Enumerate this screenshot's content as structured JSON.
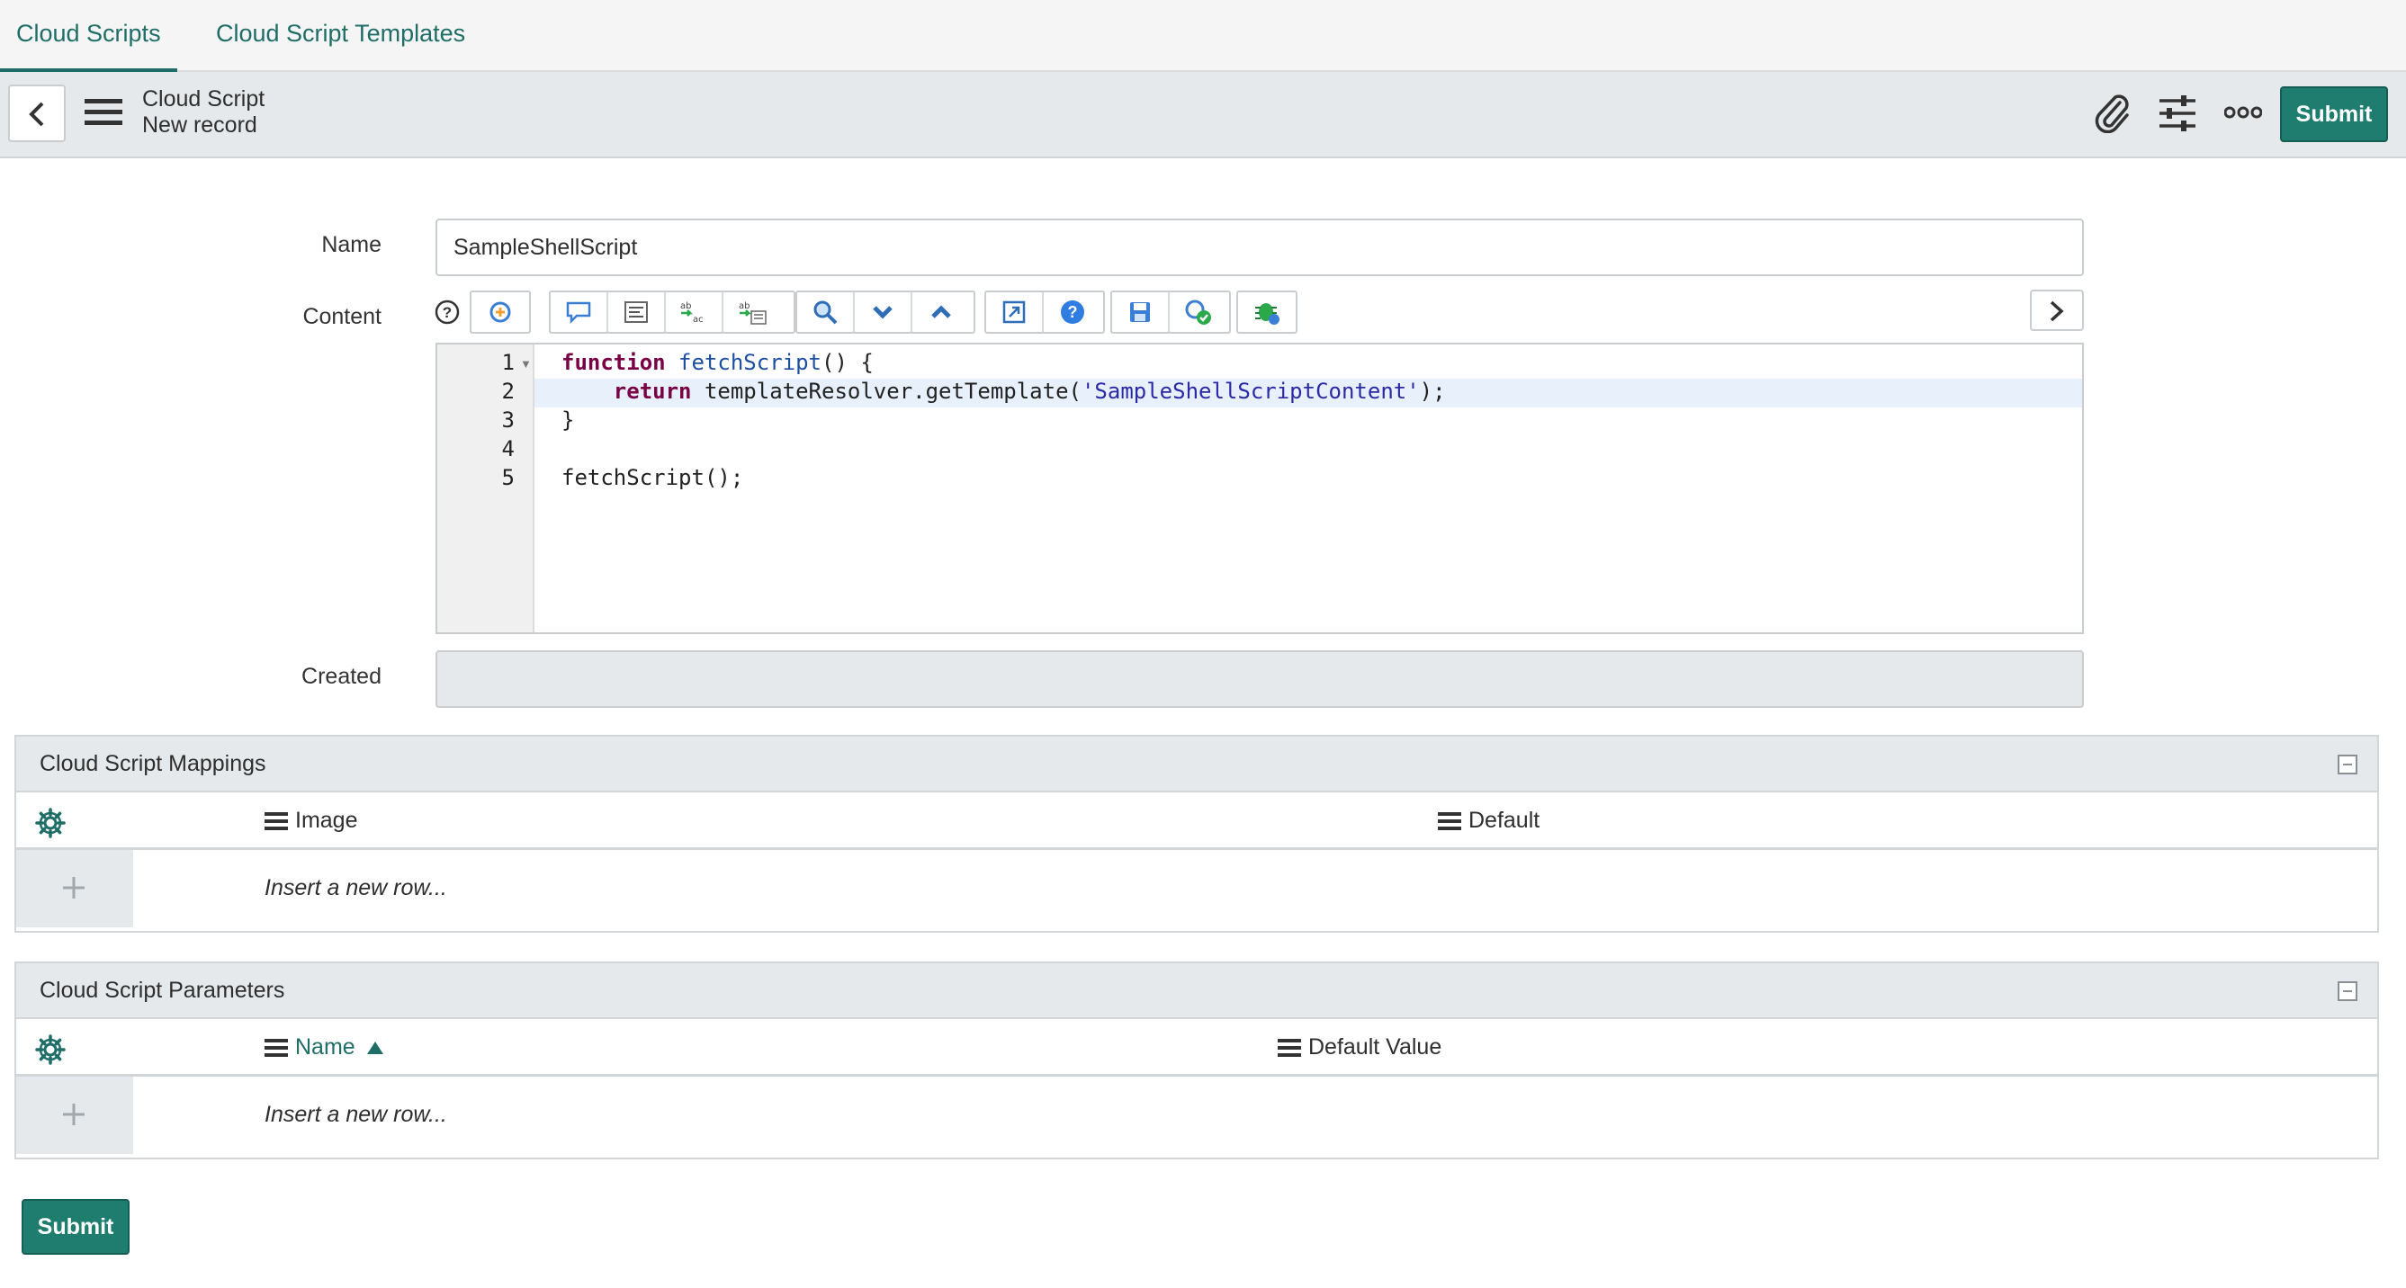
{
  "tabs": [
    {
      "label": "Cloud Scripts",
      "active": true
    },
    {
      "label": "Cloud Script Templates",
      "active": false
    }
  ],
  "header": {
    "title": "Cloud Script",
    "subtitle": "New record",
    "icons": [
      "attachment-icon",
      "settings-sliders-icon",
      "more-options-icon"
    ],
    "submit_label": "Submit"
  },
  "form": {
    "name_label": "Name",
    "name_value": "SampleShellScript",
    "content_label": "Content",
    "created_label": "Created",
    "created_value": "",
    "toolbar_icons": [
      "script-include-icon",
      "comment-icon",
      "format-code-icon",
      "replace-icon",
      "replace-all-icon",
      "search-icon",
      "find-next-icon",
      "find-previous-icon",
      "fullscreen-icon",
      "help-icon",
      "save-icon",
      "script-validate-icon",
      "debug-icon"
    ],
    "code_line_numbers": [
      "1",
      "2",
      "3",
      "4",
      "5"
    ],
    "code": [
      {
        "kw": "function",
        "fn": "fetchScript",
        "rest": "() {"
      },
      {
        "indent": "    ",
        "kw": "return",
        "mid": " templateResolver.getTemplate(",
        "str": "'SampleShellScriptContent'",
        "end": ");"
      },
      {
        "text": "}"
      },
      {
        "text": ""
      },
      {
        "text": "fetchScript();"
      }
    ]
  },
  "mappings": {
    "title": "Cloud Script Mappings",
    "columns": [
      "Image",
      "Default"
    ],
    "insert_text": "Insert a new row..."
  },
  "parameters": {
    "title": "Cloud Script Parameters",
    "columns": [
      "Name",
      "Default Value"
    ],
    "sort_column": "Name",
    "insert_text": "Insert a new row..."
  },
  "footer": {
    "submit_label": "Submit"
  },
  "colors": {
    "accent": "#1f6d67",
    "button": "#1f7d6f",
    "header_bg": "#e6e9eb"
  }
}
